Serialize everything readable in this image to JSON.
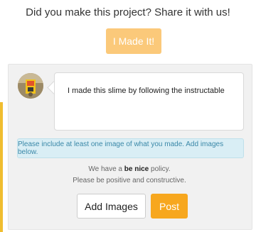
{
  "header": {
    "prompt": "Did you make this project? Share it with us!"
  },
  "made_it_button": "I Made It!",
  "comment": {
    "text": "I made this slime by following the instructable"
  },
  "info_message": "Please include at least one image of what you made. Add images below.",
  "policy": {
    "prefix": "We have a ",
    "bold": "be nice",
    "suffix": " policy.",
    "line2": "Please be positive and constructive."
  },
  "buttons": {
    "add_images": "Add Images",
    "post": "Post"
  },
  "colors": {
    "accent": "#f7a71e",
    "accent_light": "#fbc97a",
    "info_bg": "#d9eef5",
    "info_text": "#3a88a8"
  }
}
